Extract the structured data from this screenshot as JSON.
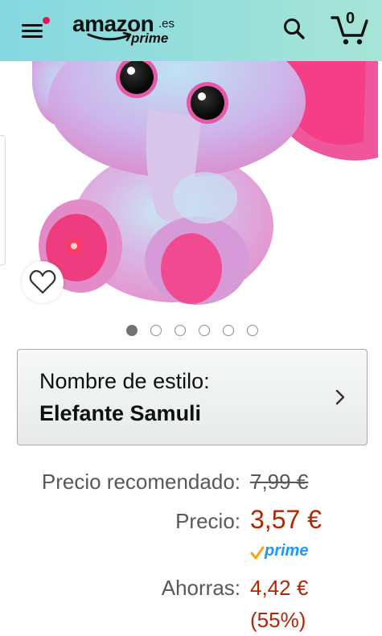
{
  "header": {
    "logo_text": "amazon",
    "logo_tld": ".es",
    "logo_sub": "prime",
    "cart_count": "0",
    "icons": {
      "menu": "menu-icon",
      "search": "search-icon",
      "cart": "cart-icon",
      "notification": "notification-dot"
    },
    "colors": {
      "bar_start": "#84d8e0",
      "bar_end": "#a6e5d6",
      "notification_dot": "#e4145d"
    }
  },
  "product_image": {
    "wishlist_icon": "heart-icon"
  },
  "carousel": {
    "image_count": 6,
    "active_index": 0
  },
  "style_selector": {
    "label": "Nombre de estilo:",
    "value": "Elefante Samuli",
    "icon": "chevron-right-icon"
  },
  "pricing": {
    "list_price_label": "Precio recomendado:",
    "list_price": "7,99 €",
    "price_label": "Precio:",
    "price": "3,57 €",
    "prime_label": "prime",
    "savings_label": "Ahorras:",
    "savings_amount": "4,42 €",
    "savings_percent": "(55%)",
    "colors": {
      "price": "#b12704",
      "prime": "#1a98ff",
      "prime_check": "#f7a21b"
    }
  }
}
